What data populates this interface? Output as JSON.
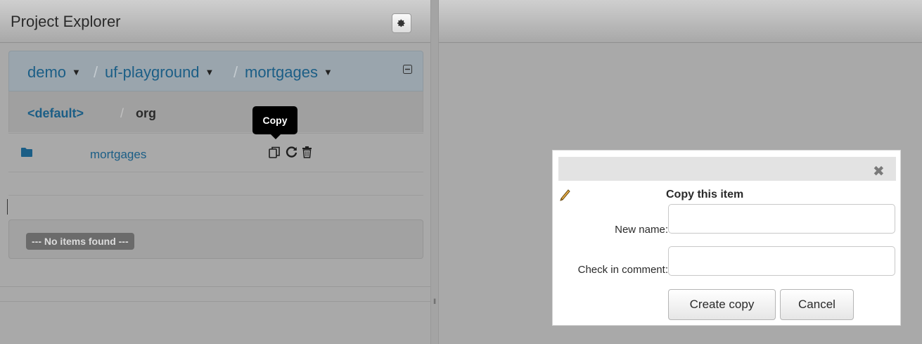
{
  "explorer": {
    "title": "Project Explorer",
    "settings_icon": "gear-icon"
  },
  "breadcrumb": {
    "items": [
      {
        "label": "demo"
      },
      {
        "label": "uf-playground"
      },
      {
        "label": "mortgages"
      }
    ],
    "separator": "/",
    "collapse_icon": "collapse-icon"
  },
  "path": {
    "branch": "<default>",
    "separator": "/",
    "package": "org"
  },
  "items": [
    {
      "name": "mortgages",
      "icon": "folder-icon"
    }
  ],
  "tooltip": {
    "text": "Copy"
  },
  "empty": {
    "text": "--- No items found ---"
  },
  "dialog": {
    "title": "Copy this item",
    "new_name_label": "New name:",
    "new_name_value": "",
    "comment_label": "Check in comment:",
    "comment_value": "",
    "create_label": "Create copy",
    "cancel_label": "Cancel",
    "close_glyph": "✖"
  },
  "colors": {
    "link": "#1b5e86",
    "overlay": "#a9a9a9"
  }
}
